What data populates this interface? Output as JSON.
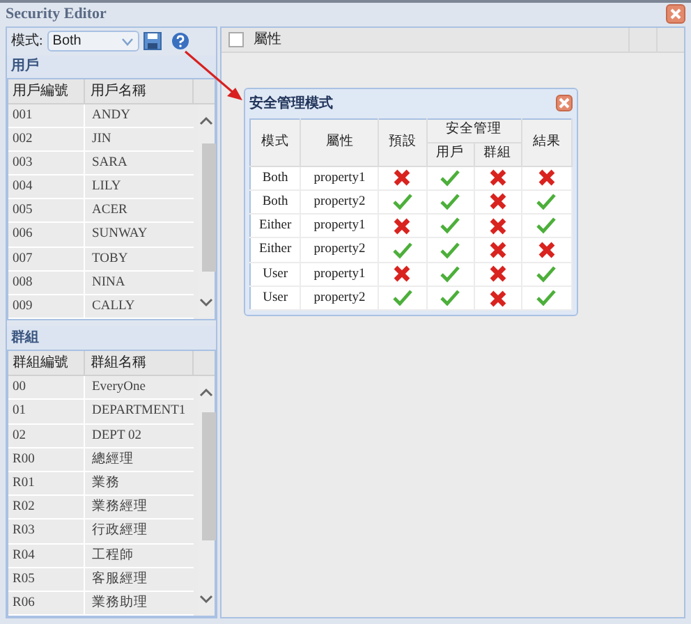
{
  "window": {
    "title": "Security Editor"
  },
  "toolbar": {
    "mode_label": "模式:",
    "mode_value": "Both"
  },
  "users": {
    "title": "用戶",
    "columns": [
      "用戶編號",
      "用戶名稱"
    ],
    "rows": [
      [
        "001",
        "ANDY"
      ],
      [
        "002",
        "JIN"
      ],
      [
        "003",
        "SARA"
      ],
      [
        "004",
        "LILY"
      ],
      [
        "005",
        "ACER"
      ],
      [
        "006",
        "SUNWAY"
      ],
      [
        "007",
        "TOBY"
      ],
      [
        "008",
        "NINA"
      ],
      [
        "009",
        "CALLY"
      ]
    ]
  },
  "groups": {
    "title": "群組",
    "columns": [
      "群組編號",
      "群組名稱"
    ],
    "rows": [
      [
        "00",
        "EveryOne"
      ],
      [
        "01",
        "DEPARTMENT1"
      ],
      [
        "02",
        "DEPT 02"
      ],
      [
        "R00",
        "總經理"
      ],
      [
        "R01",
        "業務"
      ],
      [
        "R02",
        "業務經理"
      ],
      [
        "R03",
        "行政經理"
      ],
      [
        "R04",
        "工程師"
      ],
      [
        "R05",
        "客服經理"
      ],
      [
        "R06",
        "業務助理"
      ]
    ]
  },
  "properties": {
    "checked": false,
    "column": "屬性"
  },
  "popup": {
    "title": "安全管理模式",
    "columns": {
      "mode": "模式",
      "property": "屬性",
      "default": "預設",
      "security": "安全管理",
      "user": "用戶",
      "group": "群組",
      "result": "結果"
    },
    "rows": [
      {
        "mode": "Both",
        "property": "property1",
        "default": false,
        "user": true,
        "group": false,
        "result": false
      },
      {
        "mode": "Both",
        "property": "property2",
        "default": true,
        "user": true,
        "group": false,
        "result": true
      },
      {
        "mode": "Either",
        "property": "property1",
        "default": false,
        "user": true,
        "group": false,
        "result": true
      },
      {
        "mode": "Either",
        "property": "property2",
        "default": true,
        "user": true,
        "group": false,
        "result": false
      },
      {
        "mode": "User",
        "property": "property1",
        "default": false,
        "user": true,
        "group": false,
        "result": true
      },
      {
        "mode": "User",
        "property": "property2",
        "default": true,
        "user": true,
        "group": false,
        "result": true
      }
    ]
  }
}
